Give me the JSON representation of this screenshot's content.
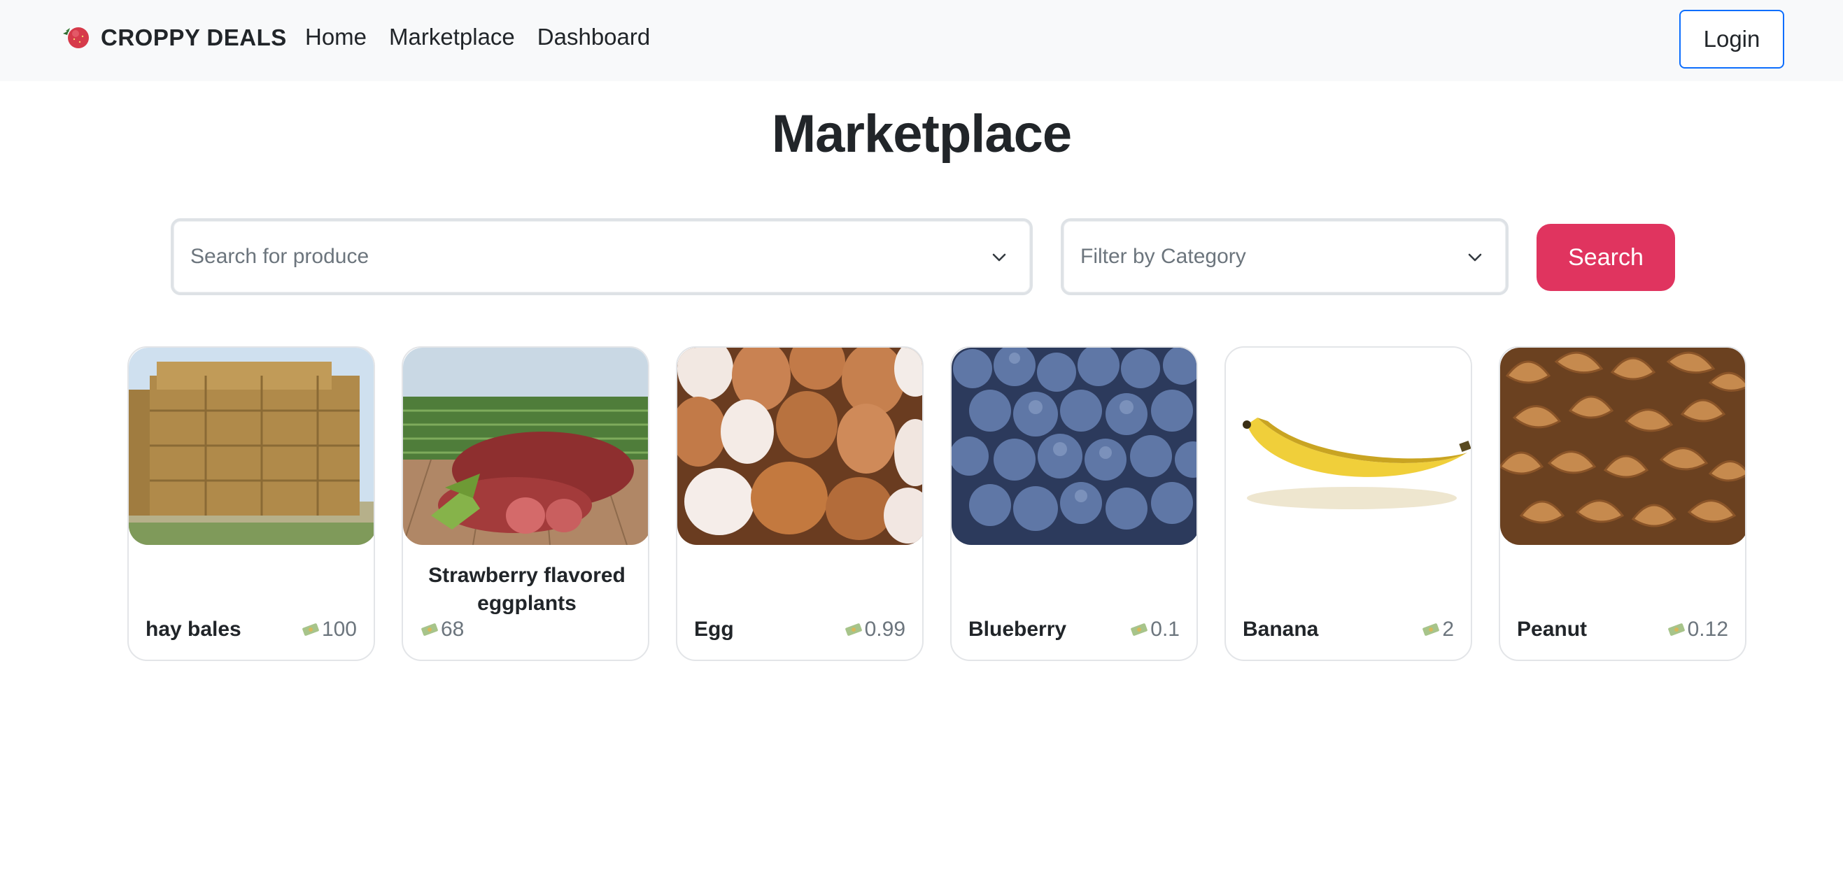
{
  "nav": {
    "brand": "CROPPY DEALS",
    "links": [
      "Home",
      "Marketplace",
      "Dashboard"
    ],
    "login": "Login"
  },
  "page": {
    "title": "Marketplace"
  },
  "search": {
    "placeholder": "Search for produce",
    "filter_placeholder": "Filter by Category",
    "button": "Search"
  },
  "products": [
    {
      "name": "hay bales",
      "price": "100"
    },
    {
      "name": "Strawberry flavored eggplants",
      "price": "68"
    },
    {
      "name": "Egg",
      "price": "0.99"
    },
    {
      "name": "Blueberry",
      "price": "0.1"
    },
    {
      "name": "Banana",
      "price": "2"
    },
    {
      "name": "Peanut",
      "price": "0.12"
    }
  ],
  "colors": {
    "accent": "#e0345f",
    "login_border": "#0d6efd",
    "navbar_bg": "#f8f9fa"
  },
  "icons": {
    "brand": "strawberry-icon",
    "price": "money-bag-icon",
    "dropdown": "chevron-down-icon"
  }
}
